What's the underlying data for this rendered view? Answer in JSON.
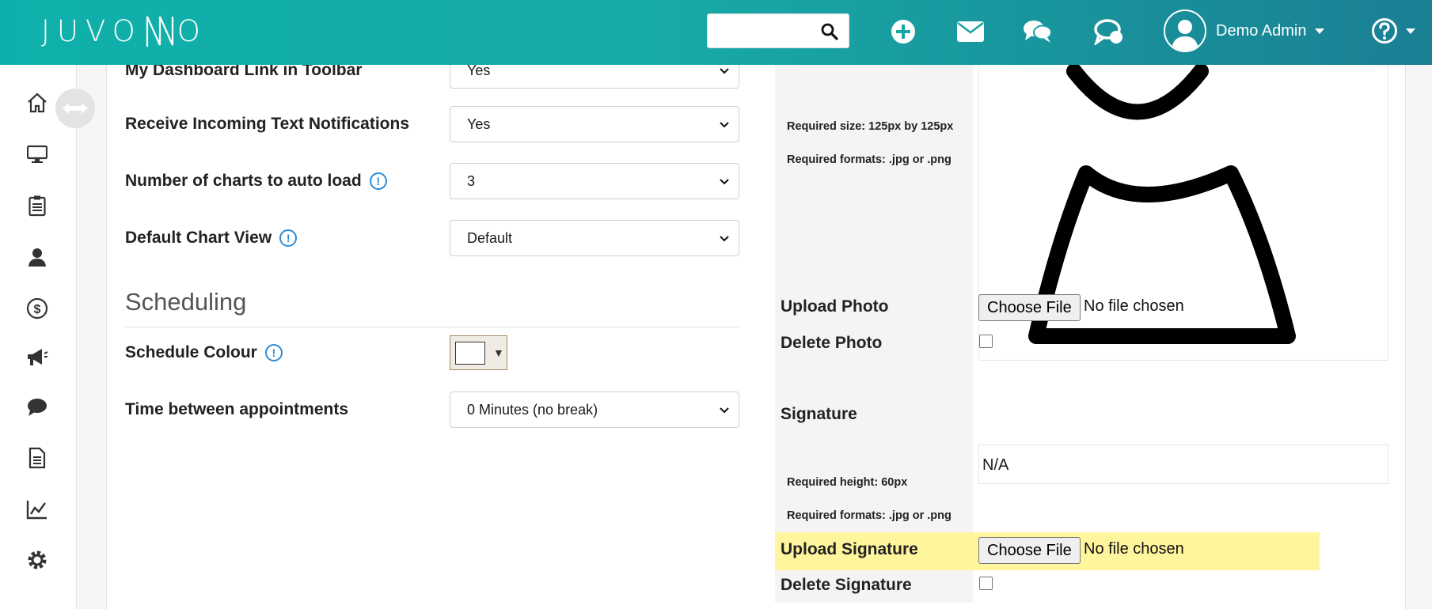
{
  "brand": {
    "name": "JUVONNO"
  },
  "topbar": {
    "search": {
      "placeholder": "",
      "value": ""
    },
    "icons": [
      "search-icon",
      "add-icon",
      "mail-icon",
      "chat-icon",
      "messages-icon"
    ],
    "user": {
      "name": "Demo Admin"
    },
    "help_icon": "help-icon"
  },
  "leftnav": {
    "items": [
      "home-icon",
      "desktop-icon",
      "clipboard-icon",
      "clients-icon",
      "billing-icon",
      "marketing-icon",
      "messages-icon",
      "documents-icon",
      "reports-icon",
      "settings-icon"
    ]
  },
  "settings": {
    "dashboard_link": {
      "label": "My Dashboard Link in Toolbar",
      "value": "Yes"
    },
    "text_notifications": {
      "label": "Receive Incoming Text Notifications",
      "value": "Yes"
    },
    "charts_auto_load": {
      "label": "Number of charts to auto load",
      "value": "3"
    },
    "default_chart_view": {
      "label": "Default Chart View",
      "value": "Default"
    },
    "scheduling": {
      "title": "Scheduling",
      "schedule_colour": {
        "label": "Schedule Colour",
        "color": "#ffffff"
      },
      "time_between": {
        "label": "Time between appointments",
        "value": "0 Minutes (no break)"
      }
    }
  },
  "photo": {
    "required_size": "Required size: 125px by 125px",
    "required_formats": "Required formats: .jpg or .png",
    "upload_label": "Upload Photo",
    "delete_label": "Delete Photo",
    "choose_file": "Choose File",
    "no_file": "No file chosen"
  },
  "signature": {
    "title": "Signature",
    "value": "N/A",
    "required_height": "Required height: 60px",
    "required_formats": "Required formats: .jpg or .png",
    "upload_label": "Upload Signature",
    "delete_label": "Delete Signature",
    "choose_file": "Choose File",
    "no_file": "No file chosen"
  },
  "colors": {
    "topbar_start": "#0fb0ab",
    "topbar_end": "#1a7f93",
    "info_icon": "#2a8bd8",
    "highlight": "#fff59d"
  }
}
